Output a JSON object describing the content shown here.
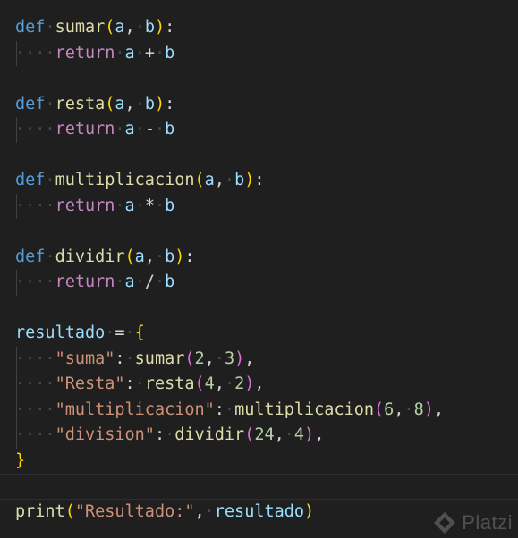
{
  "editor": {
    "indent_marker": "····",
    "sumar": {
      "kw": "def",
      "name": "sumar",
      "param_a": "a",
      "param_b": "b",
      "ret": "return",
      "op": "+"
    },
    "resta": {
      "kw": "def",
      "name": "resta",
      "param_a": "a",
      "param_b": "b",
      "ret": "return",
      "op": "-"
    },
    "multiplicacion": {
      "kw": "def",
      "name": "multiplicacion",
      "param_a": "a",
      "param_b": "b",
      "ret": "return",
      "op": "*"
    },
    "dividir": {
      "kw": "def",
      "name": "dividir",
      "param_a": "a",
      "param_b": "b",
      "ret": "return",
      "op": "/"
    },
    "resultado": {
      "var": "resultado",
      "entries": [
        {
          "key": "\"suma\"",
          "fn": "sumar",
          "arg1": "2",
          "arg2": "3"
        },
        {
          "key": "\"Resta\"",
          "fn": "resta",
          "arg1": "4",
          "arg2": "2"
        },
        {
          "key": "\"multiplicacion\"",
          "fn": "multiplicacion",
          "arg1": "6",
          "arg2": "8"
        },
        {
          "key": "\"division\"",
          "fn": "dividir",
          "arg1": "24",
          "arg2": "4"
        }
      ]
    },
    "print_line": {
      "fn": "print",
      "str": "\"Resultado:\"",
      "arg": "resultado"
    }
  },
  "watermark": {
    "text": "Platzi",
    "icon": "platzi-logo-icon"
  }
}
